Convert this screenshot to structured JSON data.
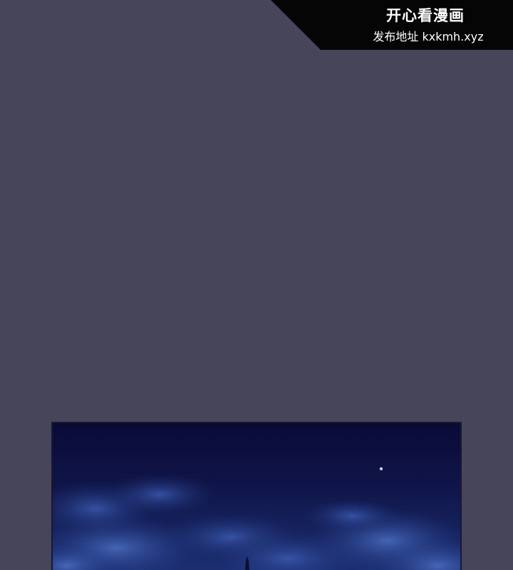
{
  "watermark": {
    "title": "开心看漫画",
    "subtitle": "发布地址 kxkmh.xyz"
  },
  "colors": {
    "page_background": "#47455a",
    "banner_background": "#050505",
    "banner_text": "#ffffff",
    "sky_dark": "#0b0c3c",
    "cloud_blue": "#2f4fa0"
  }
}
